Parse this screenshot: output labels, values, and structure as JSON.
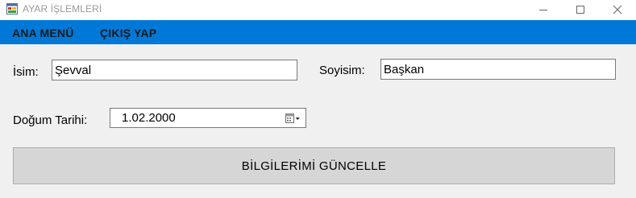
{
  "window": {
    "title": "AYAR İŞLEMLERİ",
    "icon": "form-app-icon",
    "controls": [
      "minimize-icon",
      "maximize-icon",
      "close-icon"
    ]
  },
  "menu": {
    "items": [
      {
        "label": "ANA MENÜ"
      },
      {
        "label": "ÇIKIŞ YAP"
      }
    ],
    "bar_color": "#0078d7"
  },
  "form": {
    "first_name": {
      "label": "İsim:",
      "value": "Şevval"
    },
    "last_name": {
      "label": "Soyisim:",
      "value": "Başkan"
    },
    "birth_date": {
      "label": "Doğum Tarihi:",
      "value": "1.02.2000",
      "icon": "calendar-dropdown-icon"
    },
    "update_button": {
      "label": "BİLGİLERİMİ GÜNCELLE"
    }
  }
}
